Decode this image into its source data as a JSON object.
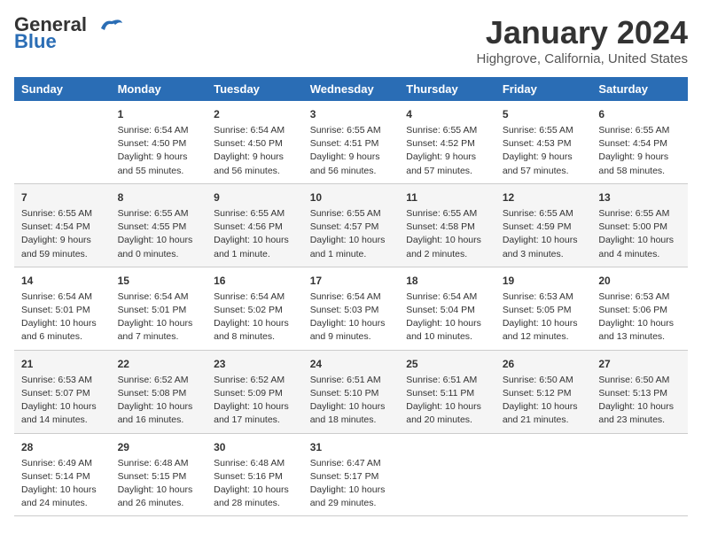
{
  "header": {
    "logo_line1": "General",
    "logo_line2": "Blue",
    "month": "January 2024",
    "location": "Highgrove, California, United States"
  },
  "days_of_week": [
    "Sunday",
    "Monday",
    "Tuesday",
    "Wednesday",
    "Thursday",
    "Friday",
    "Saturday"
  ],
  "weeks": [
    [
      {
        "day": "",
        "sunrise": "",
        "sunset": "",
        "daylight": ""
      },
      {
        "day": "1",
        "sunrise": "Sunrise: 6:54 AM",
        "sunset": "Sunset: 4:50 PM",
        "daylight": "Daylight: 9 hours and 55 minutes."
      },
      {
        "day": "2",
        "sunrise": "Sunrise: 6:54 AM",
        "sunset": "Sunset: 4:50 PM",
        "daylight": "Daylight: 9 hours and 56 minutes."
      },
      {
        "day": "3",
        "sunrise": "Sunrise: 6:55 AM",
        "sunset": "Sunset: 4:51 PM",
        "daylight": "Daylight: 9 hours and 56 minutes."
      },
      {
        "day": "4",
        "sunrise": "Sunrise: 6:55 AM",
        "sunset": "Sunset: 4:52 PM",
        "daylight": "Daylight: 9 hours and 57 minutes."
      },
      {
        "day": "5",
        "sunrise": "Sunrise: 6:55 AM",
        "sunset": "Sunset: 4:53 PM",
        "daylight": "Daylight: 9 hours and 57 minutes."
      },
      {
        "day": "6",
        "sunrise": "Sunrise: 6:55 AM",
        "sunset": "Sunset: 4:54 PM",
        "daylight": "Daylight: 9 hours and 58 minutes."
      }
    ],
    [
      {
        "day": "7",
        "sunrise": "Sunrise: 6:55 AM",
        "sunset": "Sunset: 4:54 PM",
        "daylight": "Daylight: 9 hours and 59 minutes."
      },
      {
        "day": "8",
        "sunrise": "Sunrise: 6:55 AM",
        "sunset": "Sunset: 4:55 PM",
        "daylight": "Daylight: 10 hours and 0 minutes."
      },
      {
        "day": "9",
        "sunrise": "Sunrise: 6:55 AM",
        "sunset": "Sunset: 4:56 PM",
        "daylight": "Daylight: 10 hours and 1 minute."
      },
      {
        "day": "10",
        "sunrise": "Sunrise: 6:55 AM",
        "sunset": "Sunset: 4:57 PM",
        "daylight": "Daylight: 10 hours and 1 minute."
      },
      {
        "day": "11",
        "sunrise": "Sunrise: 6:55 AM",
        "sunset": "Sunset: 4:58 PM",
        "daylight": "Daylight: 10 hours and 2 minutes."
      },
      {
        "day": "12",
        "sunrise": "Sunrise: 6:55 AM",
        "sunset": "Sunset: 4:59 PM",
        "daylight": "Daylight: 10 hours and 3 minutes."
      },
      {
        "day": "13",
        "sunrise": "Sunrise: 6:55 AM",
        "sunset": "Sunset: 5:00 PM",
        "daylight": "Daylight: 10 hours and 4 minutes."
      }
    ],
    [
      {
        "day": "14",
        "sunrise": "Sunrise: 6:54 AM",
        "sunset": "Sunset: 5:01 PM",
        "daylight": "Daylight: 10 hours and 6 minutes."
      },
      {
        "day": "15",
        "sunrise": "Sunrise: 6:54 AM",
        "sunset": "Sunset: 5:01 PM",
        "daylight": "Daylight: 10 hours and 7 minutes."
      },
      {
        "day": "16",
        "sunrise": "Sunrise: 6:54 AM",
        "sunset": "Sunset: 5:02 PM",
        "daylight": "Daylight: 10 hours and 8 minutes."
      },
      {
        "day": "17",
        "sunrise": "Sunrise: 6:54 AM",
        "sunset": "Sunset: 5:03 PM",
        "daylight": "Daylight: 10 hours and 9 minutes."
      },
      {
        "day": "18",
        "sunrise": "Sunrise: 6:54 AM",
        "sunset": "Sunset: 5:04 PM",
        "daylight": "Daylight: 10 hours and 10 minutes."
      },
      {
        "day": "19",
        "sunrise": "Sunrise: 6:53 AM",
        "sunset": "Sunset: 5:05 PM",
        "daylight": "Daylight: 10 hours and 12 minutes."
      },
      {
        "day": "20",
        "sunrise": "Sunrise: 6:53 AM",
        "sunset": "Sunset: 5:06 PM",
        "daylight": "Daylight: 10 hours and 13 minutes."
      }
    ],
    [
      {
        "day": "21",
        "sunrise": "Sunrise: 6:53 AM",
        "sunset": "Sunset: 5:07 PM",
        "daylight": "Daylight: 10 hours and 14 minutes."
      },
      {
        "day": "22",
        "sunrise": "Sunrise: 6:52 AM",
        "sunset": "Sunset: 5:08 PM",
        "daylight": "Daylight: 10 hours and 16 minutes."
      },
      {
        "day": "23",
        "sunrise": "Sunrise: 6:52 AM",
        "sunset": "Sunset: 5:09 PM",
        "daylight": "Daylight: 10 hours and 17 minutes."
      },
      {
        "day": "24",
        "sunrise": "Sunrise: 6:51 AM",
        "sunset": "Sunset: 5:10 PM",
        "daylight": "Daylight: 10 hours and 18 minutes."
      },
      {
        "day": "25",
        "sunrise": "Sunrise: 6:51 AM",
        "sunset": "Sunset: 5:11 PM",
        "daylight": "Daylight: 10 hours and 20 minutes."
      },
      {
        "day": "26",
        "sunrise": "Sunrise: 6:50 AM",
        "sunset": "Sunset: 5:12 PM",
        "daylight": "Daylight: 10 hours and 21 minutes."
      },
      {
        "day": "27",
        "sunrise": "Sunrise: 6:50 AM",
        "sunset": "Sunset: 5:13 PM",
        "daylight": "Daylight: 10 hours and 23 minutes."
      }
    ],
    [
      {
        "day": "28",
        "sunrise": "Sunrise: 6:49 AM",
        "sunset": "Sunset: 5:14 PM",
        "daylight": "Daylight: 10 hours and 24 minutes."
      },
      {
        "day": "29",
        "sunrise": "Sunrise: 6:48 AM",
        "sunset": "Sunset: 5:15 PM",
        "daylight": "Daylight: 10 hours and 26 minutes."
      },
      {
        "day": "30",
        "sunrise": "Sunrise: 6:48 AM",
        "sunset": "Sunset: 5:16 PM",
        "daylight": "Daylight: 10 hours and 28 minutes."
      },
      {
        "day": "31",
        "sunrise": "Sunrise: 6:47 AM",
        "sunset": "Sunset: 5:17 PM",
        "daylight": "Daylight: 10 hours and 29 minutes."
      },
      {
        "day": "",
        "sunrise": "",
        "sunset": "",
        "daylight": ""
      },
      {
        "day": "",
        "sunrise": "",
        "sunset": "",
        "daylight": ""
      },
      {
        "day": "",
        "sunrise": "",
        "sunset": "",
        "daylight": ""
      }
    ]
  ]
}
